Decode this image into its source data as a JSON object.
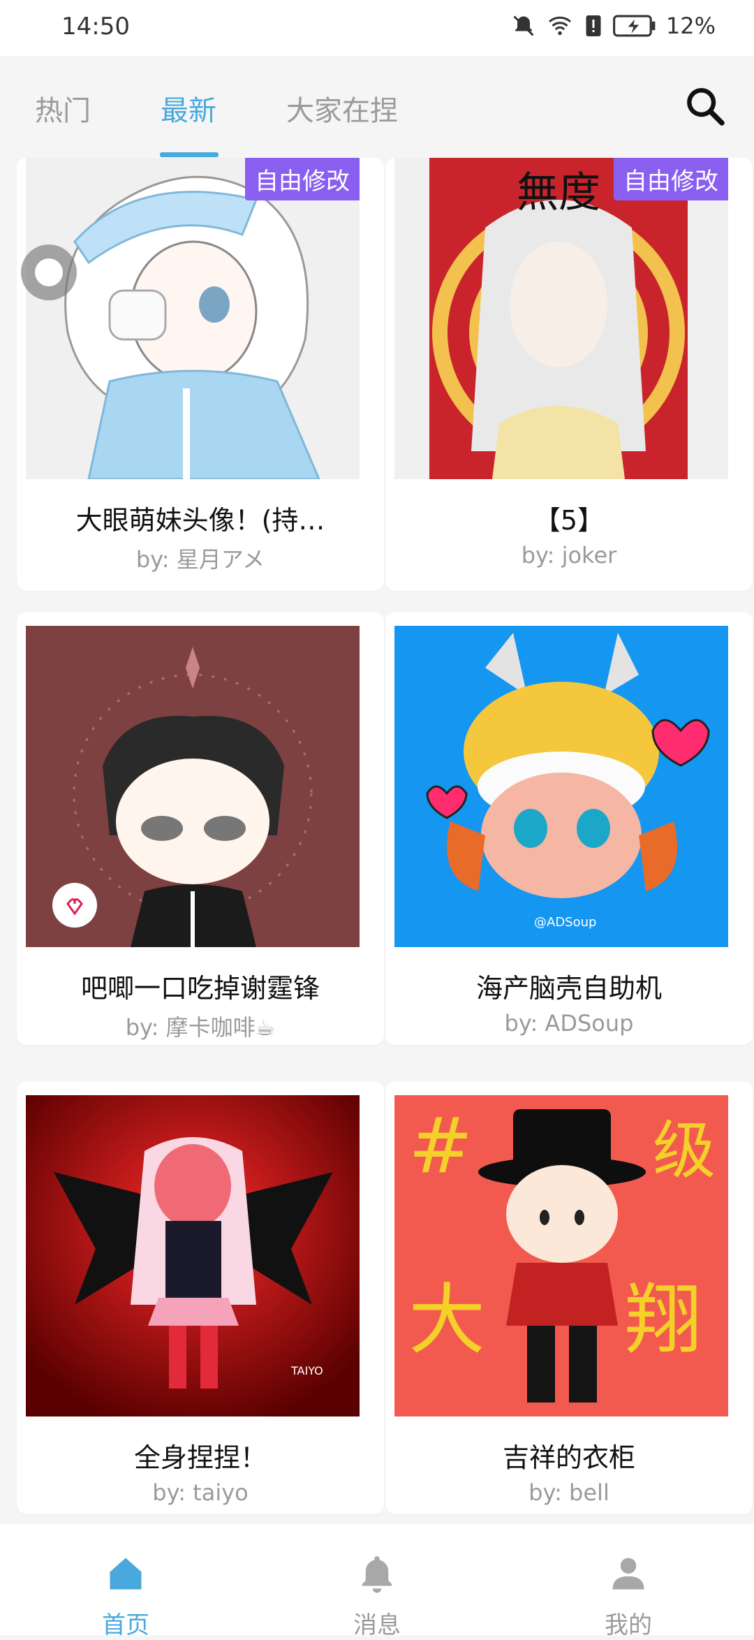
{
  "status": {
    "time": "14:50",
    "battery": "12%"
  },
  "tabs": [
    {
      "label": "热门"
    },
    {
      "label": "最新"
    },
    {
      "label": "大家在捏"
    }
  ],
  "cards": [
    {
      "title": "大眼萌妹头像！(持…",
      "author": "by: 星月アメ",
      "badge": "自由修改",
      "icon": "anime-girl-eyepatch-image"
    },
    {
      "title": "【5】",
      "author": "by: joker",
      "badge": "自由修改",
      "icon": "white-hair-character-image"
    },
    {
      "title": "吧唧一口吃掉谢霆锋",
      "author": "by: 摩卡咖啡☕",
      "icon": "chibi-man-sunglasses-image"
    },
    {
      "title": "海产脑壳自助机",
      "author": "by: ADSoup",
      "icon": "squid-girl-helmet-image"
    },
    {
      "title": "全身捏捏！",
      "author": "by: taiyo",
      "icon": "demon-wings-girl-image"
    },
    {
      "title": "吉祥的衣柜",
      "author": "by: bell",
      "icon": "top-hat-boy-image"
    }
  ],
  "nav": [
    {
      "label": "首页",
      "icon": "home-icon"
    },
    {
      "label": "消息",
      "icon": "bell-icon"
    },
    {
      "label": "我的",
      "icon": "user-icon"
    }
  ],
  "colors": {
    "accent": "#49a8dd",
    "badge": "#8a5ff0",
    "muted": "#9a9a9a"
  }
}
